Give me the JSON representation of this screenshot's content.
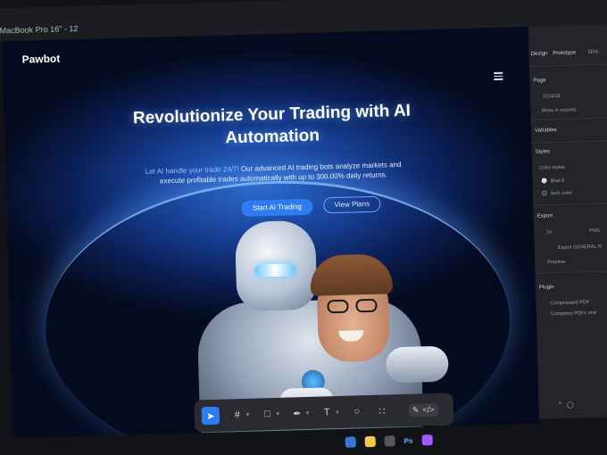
{
  "window": {
    "title": "MacBook Pro 16\" - 12"
  },
  "site": {
    "brand": "Pawbot",
    "hero": {
      "title": "Revolutionize Your Trading with AI Automation",
      "subtitle_highlight": "Let AI handle your trade 24/7!",
      "subtitle_rest": " Our advanced AI trading bots analyze markets and execute profitable trades automatically with up to 300.00% daily returns.",
      "primary_cta": "Start AI Trading",
      "secondary_cta": "View Plans"
    },
    "colors": {
      "accent": "#2f7cf2",
      "background_deep": "#050b1f",
      "glow": "#8fc0ff"
    }
  },
  "panel": {
    "tabs": [
      "Design",
      "Prototype"
    ],
    "zoom": "50%",
    "page_label": "Page",
    "page_color": "1E1E1E",
    "show_in_exports": "Show in exports",
    "variables": "Variables",
    "styles": "Styles",
    "color_styles": "Color styles",
    "style_items": [
      "Blue 6",
      "tech color"
    ],
    "export": "Export",
    "export_scale": "1x",
    "export_format": "PNG",
    "export_button": "Export GENERAL N",
    "preview": "Preview",
    "plugin": "Plugin",
    "plugin_name": "Compressed PDF",
    "plugin_desc": "Compress PDFs and"
  },
  "toolbar": {
    "tools": [
      "move-tool",
      "frame-tool",
      "shape-tool",
      "pen-tool",
      "text-tool",
      "comment-tool",
      "actions-tool"
    ],
    "mode_segment": [
      "design-mode",
      "dev-mode"
    ]
  },
  "taskbar": {
    "photoshop": "Ps"
  }
}
